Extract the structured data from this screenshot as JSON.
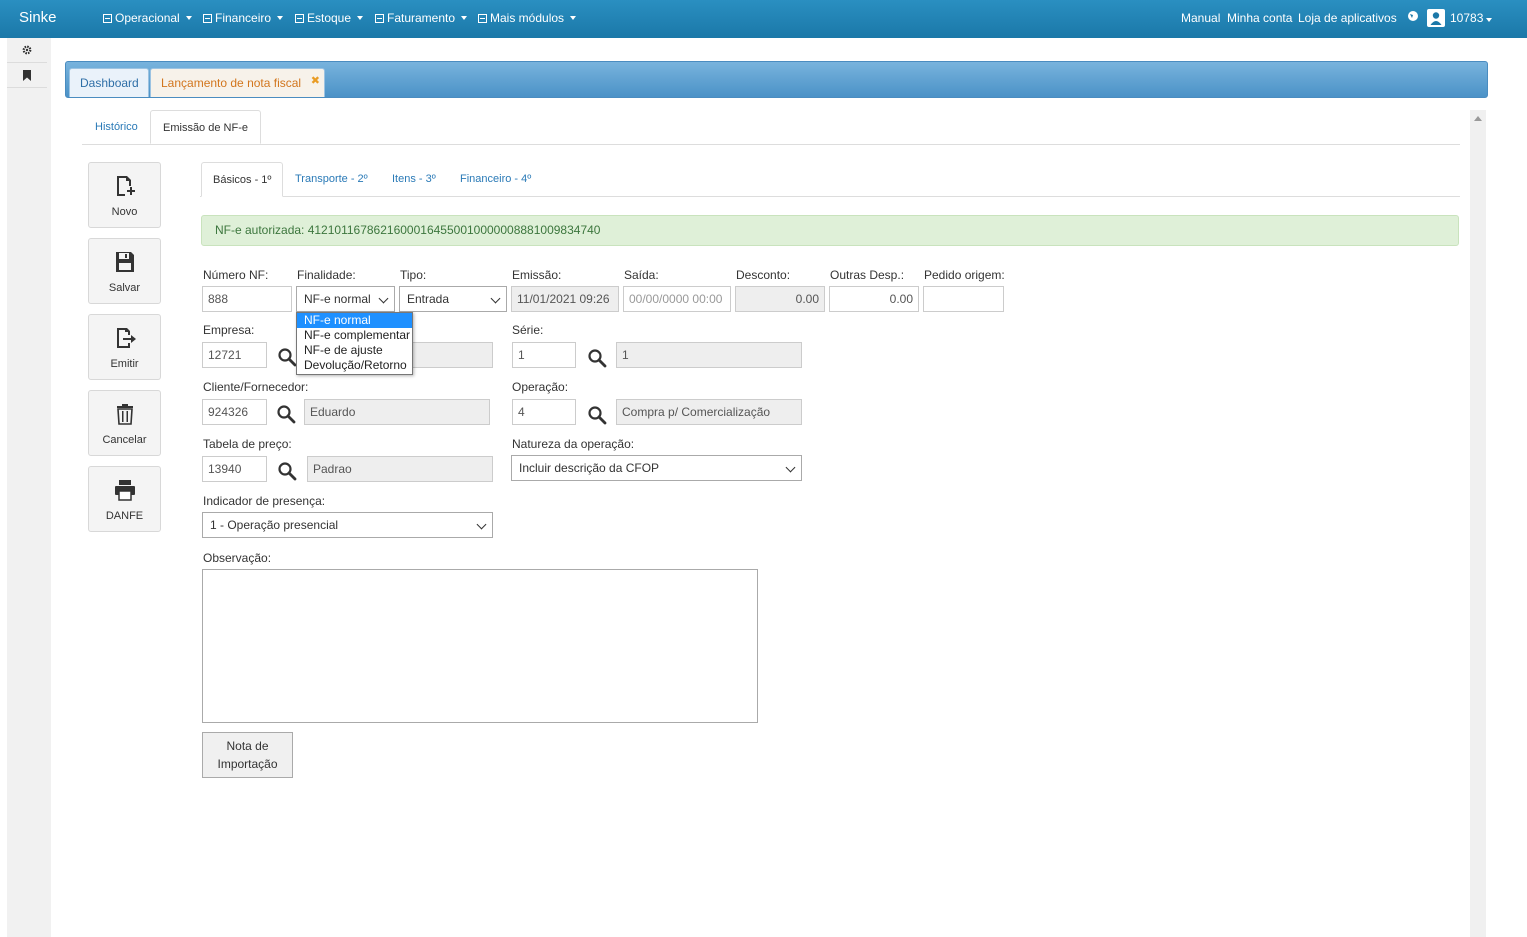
{
  "app": {
    "brand": "Sinke"
  },
  "topnav": {
    "menus": [
      {
        "label": "Operacional"
      },
      {
        "label": "Financeiro"
      },
      {
        "label": "Estoque"
      },
      {
        "label": "Faturamento"
      },
      {
        "label": "Mais módulos"
      }
    ],
    "links": {
      "manual": "Manual",
      "account": "Minha conta",
      "store": "Loja de aplicativos"
    },
    "user": "10783"
  },
  "tabs": {
    "dashboard": "Dashboard",
    "current": "Lançamento de nota fiscal"
  },
  "subtabs": {
    "history": "Histórico",
    "emission": "Emissão de NF-e"
  },
  "actions": {
    "novo": "Novo",
    "salvar": "Salvar",
    "emitir": "Emitir",
    "cancelar": "Cancelar",
    "danfe": "DANFE"
  },
  "formtabs": {
    "basicos": "Básicos - 1º",
    "transporte": "Transporte - 2º",
    "itens": "Itens - 3º",
    "financeiro": "Financeiro - 4º"
  },
  "alert": "NF-e autorizada: 41210116786216000164550010000008881009834740",
  "form": {
    "numero_label": "Número NF:",
    "numero_value": "888",
    "finalidade_label": "Finalidade:",
    "finalidade_value": "NF-e normal",
    "tipo_label": "Tipo:",
    "tipo_value": "Entrada",
    "emissao_label": "Emissão:",
    "emissao_value": "11/01/2021 09:26",
    "saida_label": "Saída:",
    "saida_placeholder": "00/00/0000 00:00",
    "desconto_label": "Desconto:",
    "desconto_value": "0.00",
    "outras_label": "Outras Desp.:",
    "outras_value": "0.00",
    "pedido_label": "Pedido origem:",
    "pedido_value": "",
    "empresa_label": "Empresa:",
    "empresa_value": "12721",
    "serie_label": "Série:",
    "serie_value": "1",
    "serie_desc": "1",
    "cliente_label": "Cliente/Fornecedor:",
    "cliente_value": "924326",
    "cliente_desc": "Eduardo",
    "operacao_label": "Operação:",
    "operacao_value": "4",
    "operacao_desc": "Compra p/ Comercialização",
    "tabela_label": "Tabela de preço:",
    "tabela_value": "13940",
    "tabela_desc": "Padrao",
    "natureza_label": "Natureza da operação:",
    "natureza_value": "Incluir descrição da CFOP",
    "presenca_label": "Indicador de presença:",
    "presenca_value": "1 - Operação presencial",
    "obs_label": "Observação:",
    "import_button_line1": "Nota de",
    "import_button_line2": "Importação"
  },
  "finalidade_options": [
    "NF-e normal",
    "NF-e complementar",
    "NF-e de ajuste",
    "Devolução/Retorno"
  ],
  "colors": {
    "topbar": "#1b78a8",
    "alert_bg": "#dff0d8",
    "alert_text": "#3c763d",
    "highlight": "#1e90ff",
    "active_tab_text": "#d2761e"
  }
}
